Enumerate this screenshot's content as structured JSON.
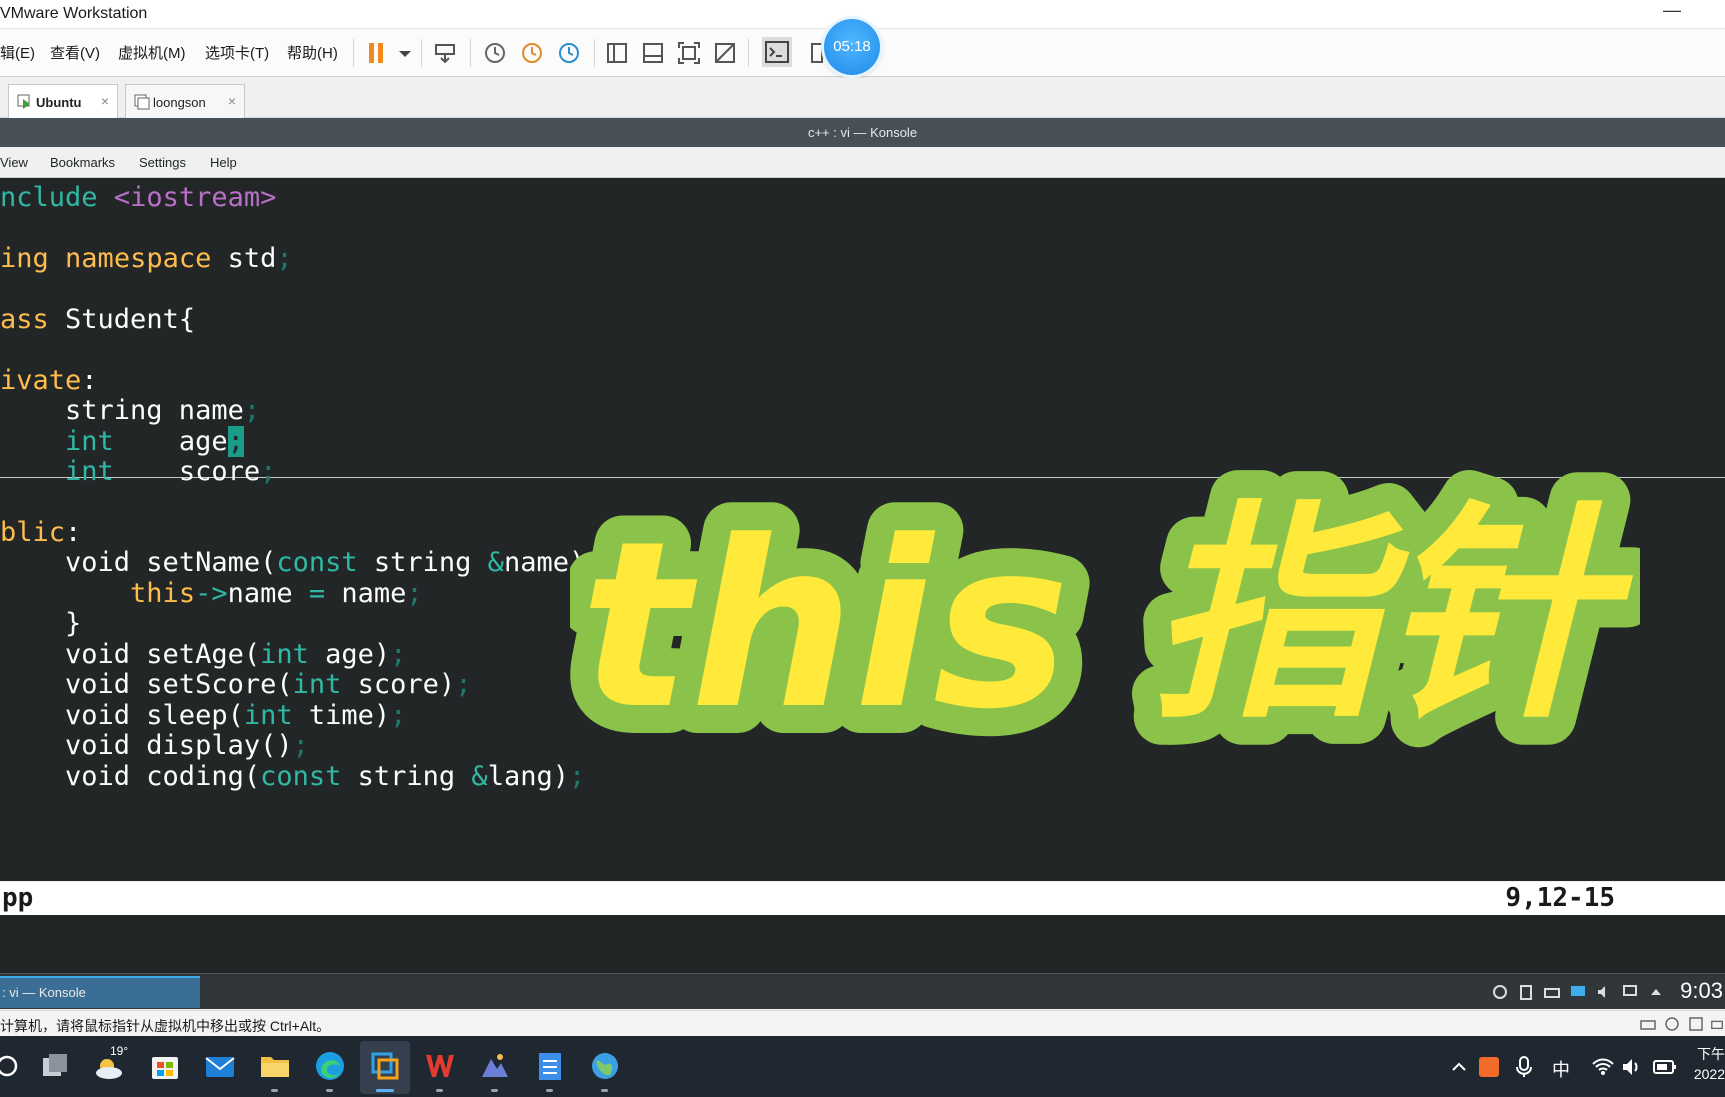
{
  "vmware": {
    "title": "VMware Workstation",
    "minimize": "—",
    "menu": [
      "辑(E)",
      "查看(V)",
      "虚拟机(M)",
      "选项卡(T)",
      "帮助(H)"
    ],
    "timer": "05:18",
    "tabs": [
      {
        "label": "Ubuntu",
        "close": "×",
        "active": true
      },
      {
        "label": "loongson",
        "close": "×",
        "active": false
      }
    ],
    "status_message": "计算机，请将鼠标指针从虚拟机中移出或按 Ctrl+Alt。"
  },
  "konsole": {
    "title": "c++ : vi — Konsole",
    "menu": [
      "View",
      "Bookmarks",
      "Settings",
      "Help"
    ],
    "code": {
      "l1": [
        "nclude",
        " ",
        "<iostream>"
      ],
      "l2": [
        "ing",
        " ",
        "namespace",
        " std",
        ";"
      ],
      "l3": [
        "ass",
        " Student{"
      ],
      "l4": [
        "ivate",
        ":"
      ],
      "l5": [
        "    string name",
        ";"
      ],
      "l6": [
        "    ",
        "int",
        "    age",
        ";"
      ],
      "l7": [
        "    ",
        "int",
        "    score",
        ";"
      ],
      "l8": [
        "blic",
        ":"
      ],
      "l9": [
        "    void setName(",
        "const",
        " string ",
        "&",
        "name){"
      ],
      "l10": [
        "        ",
        "this",
        "->",
        "name ",
        "=",
        " name",
        ";"
      ],
      "l11": [
        "    }"
      ],
      "l12": [
        "    void setAge(",
        "int",
        " age)",
        ";"
      ],
      "l13": [
        "    void setScore(",
        "int",
        " score)",
        ";"
      ],
      "l14": [
        "    void sleep(",
        "int",
        " time)",
        ";"
      ],
      "l15": [
        "    void display()",
        ";"
      ],
      "l16": [
        "    void coding(",
        "const",
        " string ",
        "&",
        "lang)",
        ";"
      ]
    },
    "status_left": "pp",
    "status_right": "9,12-15"
  },
  "guest_taskbar": {
    "task_label": ": vi — Konsole",
    "clock": "9:03"
  },
  "windows_taskbar": {
    "weather_temp": "19°",
    "ime": "中",
    "clock_line1": "下午",
    "clock_line2": "2022"
  },
  "overlay": {
    "text_en": "this",
    "text_zh": "指针",
    "fill_color": "#ffe93a",
    "outline_color": "#8bc34a"
  }
}
